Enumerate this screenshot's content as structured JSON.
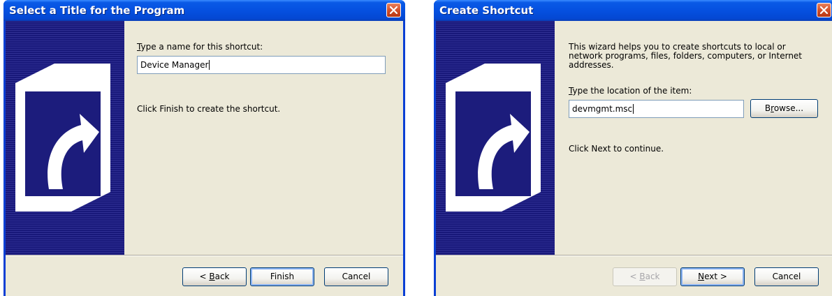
{
  "dialogs": [
    {
      "title": "Select a Title for the Program",
      "prompt_accel": "T",
      "prompt_rest": "ype a name for this shortcut:",
      "name_value": "Device Manager",
      "instruction": "Click Finish to create the shortcut.",
      "back_accel": "B",
      "back_prefix": "< ",
      "back_rest": "ack",
      "finish_label": "Finish",
      "cancel_label": "Cancel"
    },
    {
      "title": "Create Shortcut",
      "intro": "This wizard helps you to create shortcuts to local or network programs, files, folders, computers, or Internet addresses.",
      "prompt_accel": "T",
      "prompt_rest": "ype the location of the item:",
      "location_value": "devmgmt.msc",
      "browse_accel": "r",
      "browse_prefix": "B",
      "browse_rest": "owse...",
      "instruction": "Click Next to continue.",
      "back_accel": "B",
      "back_prefix": "< ",
      "back_rest": "ack",
      "next_accel": "N",
      "next_rest": "ext >",
      "cancel_label": "Cancel"
    }
  ],
  "icons": {
    "close": "close-x-icon",
    "banner": "shortcut-arrow-icon"
  },
  "colors": {
    "titlebar": "#0550e0",
    "dialog_face": "#ece9d8",
    "banner": "#1c1c7c",
    "close_button": "#d4502a"
  }
}
